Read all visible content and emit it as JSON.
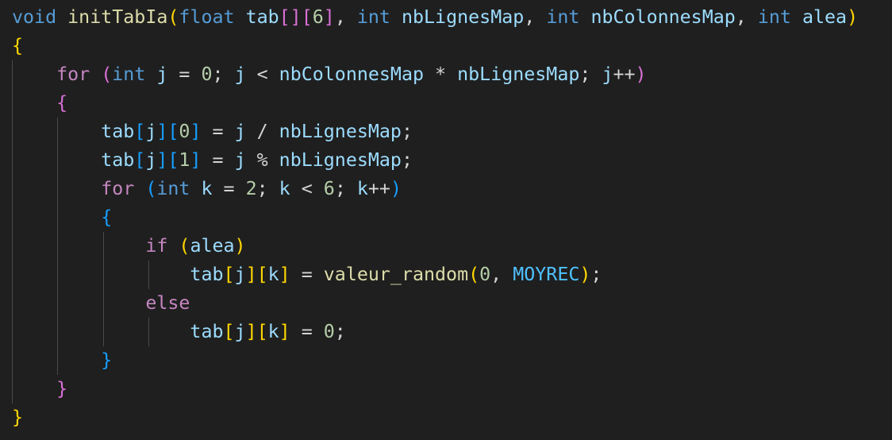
{
  "code_lines": [
    [
      {
        "t": "void",
        "c": "kw-type"
      },
      {
        "t": " ",
        "c": "op"
      },
      {
        "t": "initTabIa",
        "c": "fn"
      },
      {
        "t": "(",
        "c": "b1"
      },
      {
        "t": "float",
        "c": "kw-type"
      },
      {
        "t": " ",
        "c": "op"
      },
      {
        "t": "tab",
        "c": "var"
      },
      {
        "t": "[]",
        "c": "b2"
      },
      {
        "t": "[",
        "c": "b2"
      },
      {
        "t": "6",
        "c": "num"
      },
      {
        "t": "]",
        "c": "b2"
      },
      {
        "t": ", ",
        "c": "op"
      },
      {
        "t": "int",
        "c": "kw-type"
      },
      {
        "t": " ",
        "c": "op"
      },
      {
        "t": "nbLignesMap",
        "c": "var"
      },
      {
        "t": ", ",
        "c": "op"
      },
      {
        "t": "int",
        "c": "kw-type"
      },
      {
        "t": " ",
        "c": "op"
      },
      {
        "t": "nbColonnesMap",
        "c": "var"
      },
      {
        "t": ", ",
        "c": "op"
      },
      {
        "t": "int",
        "c": "kw-type"
      },
      {
        "t": " ",
        "c": "op"
      },
      {
        "t": "alea",
        "c": "var"
      },
      {
        "t": ")",
        "c": "b1"
      }
    ],
    [
      {
        "t": "{",
        "c": "b1"
      }
    ],
    [
      {
        "t": "    ",
        "c": "op"
      },
      {
        "t": "for",
        "c": "kw-ctl"
      },
      {
        "t": " ",
        "c": "op"
      },
      {
        "t": "(",
        "c": "b2"
      },
      {
        "t": "int",
        "c": "kw-type"
      },
      {
        "t": " ",
        "c": "op"
      },
      {
        "t": "j",
        "c": "var"
      },
      {
        "t": " = ",
        "c": "op"
      },
      {
        "t": "0",
        "c": "num"
      },
      {
        "t": "; ",
        "c": "op"
      },
      {
        "t": "j",
        "c": "var"
      },
      {
        "t": " < ",
        "c": "op"
      },
      {
        "t": "nbColonnesMap",
        "c": "var"
      },
      {
        "t": " * ",
        "c": "op"
      },
      {
        "t": "nbLignesMap",
        "c": "var"
      },
      {
        "t": "; ",
        "c": "op"
      },
      {
        "t": "j",
        "c": "var"
      },
      {
        "t": "++",
        "c": "op"
      },
      {
        "t": ")",
        "c": "b2"
      }
    ],
    [
      {
        "t": "    ",
        "c": "op"
      },
      {
        "t": "{",
        "c": "b2"
      }
    ],
    [
      {
        "t": "        ",
        "c": "op"
      },
      {
        "t": "tab",
        "c": "var"
      },
      {
        "t": "[",
        "c": "b3"
      },
      {
        "t": "j",
        "c": "var"
      },
      {
        "t": "]",
        "c": "b3"
      },
      {
        "t": "[",
        "c": "b3"
      },
      {
        "t": "0",
        "c": "num"
      },
      {
        "t": "]",
        "c": "b3"
      },
      {
        "t": " = ",
        "c": "op"
      },
      {
        "t": "j",
        "c": "var"
      },
      {
        "t": " / ",
        "c": "op"
      },
      {
        "t": "nbLignesMap",
        "c": "var"
      },
      {
        "t": ";",
        "c": "op"
      }
    ],
    [
      {
        "t": "        ",
        "c": "op"
      },
      {
        "t": "tab",
        "c": "var"
      },
      {
        "t": "[",
        "c": "b3"
      },
      {
        "t": "j",
        "c": "var"
      },
      {
        "t": "]",
        "c": "b3"
      },
      {
        "t": "[",
        "c": "b3"
      },
      {
        "t": "1",
        "c": "num"
      },
      {
        "t": "]",
        "c": "b3"
      },
      {
        "t": " = ",
        "c": "op"
      },
      {
        "t": "j",
        "c": "var"
      },
      {
        "t": " % ",
        "c": "op"
      },
      {
        "t": "nbLignesMap",
        "c": "var"
      },
      {
        "t": ";",
        "c": "op"
      }
    ],
    [
      {
        "t": "        ",
        "c": "op"
      },
      {
        "t": "for",
        "c": "kw-ctl"
      },
      {
        "t": " ",
        "c": "op"
      },
      {
        "t": "(",
        "c": "b3"
      },
      {
        "t": "int",
        "c": "kw-type"
      },
      {
        "t": " ",
        "c": "op"
      },
      {
        "t": "k",
        "c": "var"
      },
      {
        "t": " = ",
        "c": "op"
      },
      {
        "t": "2",
        "c": "num"
      },
      {
        "t": "; ",
        "c": "op"
      },
      {
        "t": "k",
        "c": "var"
      },
      {
        "t": " < ",
        "c": "op"
      },
      {
        "t": "6",
        "c": "num"
      },
      {
        "t": "; ",
        "c": "op"
      },
      {
        "t": "k",
        "c": "var"
      },
      {
        "t": "++",
        "c": "op"
      },
      {
        "t": ")",
        "c": "b3"
      }
    ],
    [
      {
        "t": "        ",
        "c": "op"
      },
      {
        "t": "{",
        "c": "b3"
      }
    ],
    [
      {
        "t": "            ",
        "c": "op"
      },
      {
        "t": "if",
        "c": "kw-ctl"
      },
      {
        "t": " ",
        "c": "op"
      },
      {
        "t": "(",
        "c": "b1"
      },
      {
        "t": "alea",
        "c": "var"
      },
      {
        "t": ")",
        "c": "b1"
      }
    ],
    [
      {
        "t": "                ",
        "c": "op"
      },
      {
        "t": "tab",
        "c": "var"
      },
      {
        "t": "[",
        "c": "b1"
      },
      {
        "t": "j",
        "c": "var"
      },
      {
        "t": "]",
        "c": "b1"
      },
      {
        "t": "[",
        "c": "b1"
      },
      {
        "t": "k",
        "c": "var"
      },
      {
        "t": "]",
        "c": "b1"
      },
      {
        "t": " = ",
        "c": "op"
      },
      {
        "t": "valeur_random",
        "c": "fn"
      },
      {
        "t": "(",
        "c": "b1"
      },
      {
        "t": "0",
        "c": "num"
      },
      {
        "t": ", ",
        "c": "op"
      },
      {
        "t": "MOYREC",
        "c": "const"
      },
      {
        "t": ")",
        "c": "b1"
      },
      {
        "t": ";",
        "c": "op"
      }
    ],
    [
      {
        "t": "            ",
        "c": "op"
      },
      {
        "t": "else",
        "c": "kw-ctl"
      }
    ],
    [
      {
        "t": "                ",
        "c": "op"
      },
      {
        "t": "tab",
        "c": "var"
      },
      {
        "t": "[",
        "c": "b1"
      },
      {
        "t": "j",
        "c": "var"
      },
      {
        "t": "]",
        "c": "b1"
      },
      {
        "t": "[",
        "c": "b1"
      },
      {
        "t": "k",
        "c": "var"
      },
      {
        "t": "]",
        "c": "b1"
      },
      {
        "t": " = ",
        "c": "op"
      },
      {
        "t": "0",
        "c": "num"
      },
      {
        "t": ";",
        "c": "op"
      }
    ],
    [
      {
        "t": "        ",
        "c": "op"
      },
      {
        "t": "}",
        "c": "b3"
      }
    ],
    [
      {
        "t": "    ",
        "c": "op"
      },
      {
        "t": "}",
        "c": "b2"
      }
    ],
    [
      {
        "t": "}",
        "c": "b1"
      }
    ]
  ],
  "theme": {
    "background": "#1f1f1f",
    "keyword_type": "#569cd6",
    "keyword_control": "#c586c0",
    "function": "#dcdcaa",
    "variable": "#9cdcfe",
    "number": "#b5cea8",
    "constant": "#4fc1ff",
    "bracket_1": "#ffd700",
    "bracket_2": "#da70d6",
    "bracket_3": "#179fff"
  }
}
